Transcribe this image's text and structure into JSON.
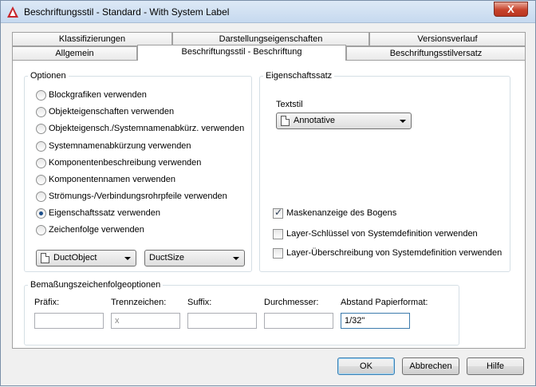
{
  "window": {
    "title": "Beschriftungsstil - Standard - With System Label",
    "close_label": "X"
  },
  "tabs": {
    "row_back": [
      "Klassifizierungen",
      "Darstellungseigenschaften",
      "Versionsverlauf"
    ],
    "row_front": [
      "Allgemein",
      "Beschriftungsstil - Beschriftung",
      "Beschriftungsstilversatz"
    ],
    "active": "Beschriftungsstil - Beschriftung"
  },
  "options": {
    "label": "Optionen",
    "radios": [
      {
        "label": "Blockgrafiken verwenden",
        "checked": false
      },
      {
        "label": "Objekteigenschaften verwenden",
        "checked": false
      },
      {
        "label": "Objekteigensch./Systemnamenabkürz. verwenden",
        "checked": false
      },
      {
        "label": "Systemnamenabkürzung verwenden",
        "checked": false
      },
      {
        "label": "Komponentenbeschreibung verwenden",
        "checked": false
      },
      {
        "label": "Komponentennamen verwenden",
        "checked": false
      },
      {
        "label": "Strömungs-/Verbindungsrohrpfeile verwenden",
        "checked": false
      },
      {
        "label": "Eigenschaftssatz verwenden",
        "checked": true
      },
      {
        "label": "Zeichenfolge verwenden",
        "checked": false
      }
    ],
    "object_combo": "DuctObject",
    "size_combo": "DuctSize"
  },
  "property_set": {
    "label": "Eigenschaftssatz",
    "textstyle_label": "Textstil",
    "textstyle_value": "Annotative",
    "checkboxes": [
      {
        "label": "Maskenanzeige des Bogens",
        "checked": true
      },
      {
        "label": "Layer-Schlüssel von Systemdefinition verwenden",
        "checked": false
      },
      {
        "label": "Layer-Überschreibung von Systemdefinition verwenden",
        "checked": false
      }
    ]
  },
  "dimension": {
    "label": "Bemaßungszeichenfolgeoptionen",
    "fields": [
      {
        "label": "Präfix:",
        "value": "",
        "placeholder": ""
      },
      {
        "label": "Trennzeichen:",
        "value": "",
        "placeholder": "x"
      },
      {
        "label": "Suffix:",
        "value": "",
        "placeholder": ""
      },
      {
        "label": "Durchmesser:",
        "value": "",
        "placeholder": ""
      },
      {
        "label": "Abstand Papierformat:",
        "value": "1/32\"",
        "placeholder": ""
      }
    ]
  },
  "buttons": {
    "ok": "OK",
    "cancel": "Abbrechen",
    "help": "Hilfe"
  },
  "colors": {
    "accent": "#1c4e8a",
    "close": "#c7432b"
  }
}
